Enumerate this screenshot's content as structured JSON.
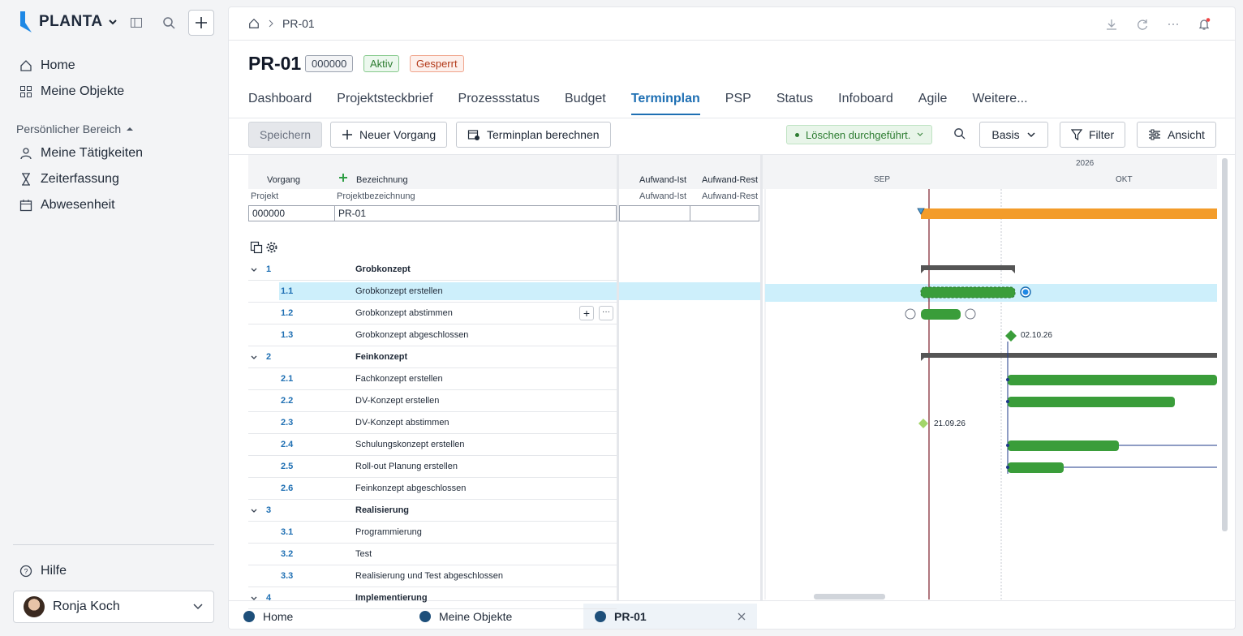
{
  "app": {
    "brand": "PLANTA"
  },
  "sidebar": {
    "home": "Home",
    "objects": "Meine Objekte",
    "section": "Persönlicher Bereich",
    "activities": "Meine Tätigkeiten",
    "time": "Zeiterfassung",
    "absence": "Abwesenheit",
    "help": "Hilfe",
    "user": "Ronja Koch"
  },
  "breadcrumb": {
    "current": "PR-01"
  },
  "project": {
    "title": "PR-01",
    "code": "000000",
    "status": "Aktiv",
    "lock": "Gesperrt"
  },
  "tabs": [
    "Dashboard",
    "Projektsteckbrief",
    "Prozessstatus",
    "Budget",
    "Terminplan",
    "PSP",
    "Status",
    "Infoboard",
    "Agile",
    "Weitere..."
  ],
  "toolbar": {
    "save": "Speichern",
    "new": "Neuer Vorgang",
    "calc": "Terminplan berechnen",
    "status": "Löschen durchgeführt.",
    "basis": "Basis",
    "filter": "Filter",
    "view": "Ansicht"
  },
  "grid": {
    "h_vorgang": "Vorgang",
    "h_bez": "Bezeichnung",
    "h_ist": "Aufwand-Ist",
    "h_rest": "Aufwand-Rest",
    "s_projekt": "Projekt",
    "s_bez": "Projektbezeichnung",
    "s_ist": "Aufwand-Ist",
    "s_rest": "Aufwand-Rest",
    "proj_code": "000000",
    "proj_name": "PR-01"
  },
  "rows": [
    {
      "num": "1",
      "name": "Grobkonzept",
      "level": 0
    },
    {
      "num": "1.1",
      "name": "Grobkonzept erstellen",
      "level": 1
    },
    {
      "num": "1.2",
      "name": "Grobkonzept abstimmen",
      "level": 1
    },
    {
      "num": "1.3",
      "name": "Grobkonzept abgeschlossen",
      "level": 1
    },
    {
      "num": "2",
      "name": "Feinkonzept",
      "level": 0
    },
    {
      "num": "2.1",
      "name": "Fachkonzept erstellen",
      "level": 1
    },
    {
      "num": "2.2",
      "name": "DV-Konzept erstellen",
      "level": 1
    },
    {
      "num": "2.3",
      "name": "DV-Konzept abstimmen",
      "level": 1
    },
    {
      "num": "2.4",
      "name": "Schulungskonzept erstellen",
      "level": 1
    },
    {
      "num": "2.5",
      "name": "Roll-out Planung erstellen",
      "level": 1
    },
    {
      "num": "2.6",
      "name": "Feinkonzept abgeschlossen",
      "level": 1
    },
    {
      "num": "3",
      "name": "Realisierung",
      "level": 0
    },
    {
      "num": "3.1",
      "name": "Programmierung",
      "level": 1
    },
    {
      "num": "3.2",
      "name": "Test",
      "level": 1
    },
    {
      "num": "3.3",
      "name": "Realisierung und Test abgeschlossen",
      "level": 1
    },
    {
      "num": "4",
      "name": "Implementierung",
      "level": 0
    }
  ],
  "gantt": {
    "year": "2026",
    "m1": "SEP",
    "m2": "OKT",
    "ms1": "02.10.26",
    "ms2": "21.09.26"
  },
  "bottomtabs": [
    "Home",
    "Meine Objekte",
    "PR-01"
  ]
}
